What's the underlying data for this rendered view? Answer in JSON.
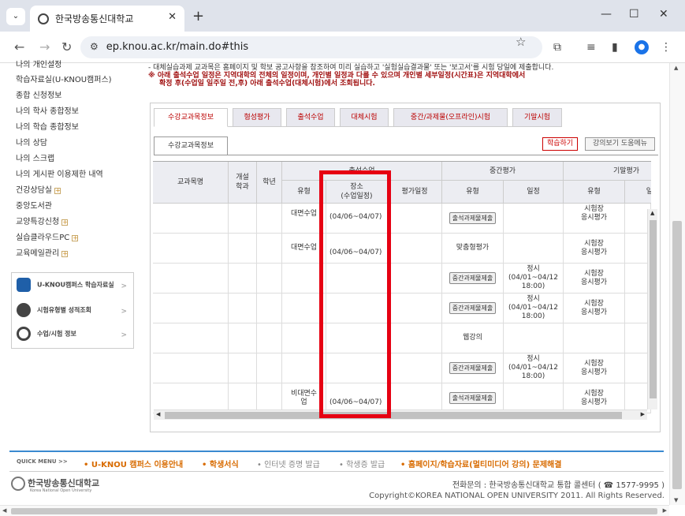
{
  "browser": {
    "tab_title": "한국방송통신대학교",
    "new_tab": "+",
    "url": "ep.knou.ac.kr/main.do#this"
  },
  "sidebar": {
    "items": [
      {
        "label": "나의 개인설정",
        "plus": false
      },
      {
        "label": "학습자료실(U-KNOU캠퍼스)",
        "plus": false
      },
      {
        "label": "종합 신청정보",
        "plus": false
      },
      {
        "label": "나의 학사 종합정보",
        "plus": false
      },
      {
        "label": "나의 학습 종합정보",
        "plus": false
      },
      {
        "label": "나의 상담",
        "plus": false
      },
      {
        "label": "나의 스크랩",
        "plus": false
      },
      {
        "label": "나의 게시판 이용제한 내역",
        "plus": false
      },
      {
        "label": "건강상담실",
        "plus": true
      },
      {
        "label": "중앙도서관",
        "plus": false
      },
      {
        "label": "교양특강신청",
        "plus": true
      },
      {
        "label": "실습클라우드PC",
        "plus": true
      },
      {
        "label": "교육메일관리",
        "plus": true
      }
    ],
    "box": [
      {
        "label": "U-KNOU캠퍼스 학습자료실",
        "icon": "u-knou-logo-icon"
      },
      {
        "label": "시험유형별 성적조회",
        "icon": "test-grade-icon"
      },
      {
        "label": "수업/시험 정보",
        "icon": "class-info-icon"
      }
    ]
  },
  "notice": {
    "line1": "- 대체실습과제 교과목은 홈페이지 및 학보 공고사항을 참조하여 미리 실습하고 '실험실습결과물' 또는 '보고서'를 시험 당일에 제출합니다.",
    "line2": "※ 아래 출석수업 일정은 지역대학의 전체의 일정이며, 개인별 일정과 다를 수 있으며 개인별 세부일정(시간표)은 지역대학에서",
    "line3": "확정 후(수업일 일주일 전,후) 아래 출석수업(대체시험)에서 조회됩니다."
  },
  "tabs": [
    "수강교과목정보",
    "형성평가",
    "출석수업",
    "대체시험",
    "중간/과제물(오프라인)시험",
    "기말시험"
  ],
  "subtab": "수강교과목정보",
  "buttons": {
    "study": "학습하기",
    "help": "강의보기 도움메뉴"
  },
  "table": {
    "headers": {
      "subject": "교과목명",
      "offer": "개설\n학과",
      "year": "학년",
      "attendance_group": "출석수업",
      "att_type": "유형",
      "att_place": "장소\n(수업일정)",
      "eval_date": "평가일정",
      "mid_group": "중간평가",
      "mid_type": "유형",
      "mid_date": "일정",
      "final_group": "기말평가",
      "final_type": "유형",
      "final_date": "일"
    },
    "rows": [
      {
        "att_type": "대면수업",
        "att_place": "(04/06~04/07)",
        "mid_button": "출석과제물제출",
        "mid_type": "",
        "mid_date": "",
        "final_type": "시험장\n응시평가"
      },
      {
        "att_type": "대면수업",
        "att_place": "(04/06~04/07)",
        "mid_button": "",
        "mid_type": "맞춤형평가",
        "mid_date": "",
        "final_type": "시험장\n응시평가"
      },
      {
        "att_type": "",
        "att_place": "",
        "mid_button": "중간과제물제출",
        "mid_type": "",
        "mid_date": "정시\n(04/01~04/12\n18:00)",
        "final_type": "시험장\n응시평가"
      },
      {
        "att_type": "",
        "att_place": "",
        "mid_button": "중간과제물제출",
        "mid_type": "",
        "mid_date": "정시\n(04/01~04/12\n18:00)",
        "final_type": "시험장\n응시평가"
      },
      {
        "att_type": "",
        "att_place": "",
        "mid_button": "",
        "mid_type": "웹강의",
        "mid_date": "",
        "final_type": ""
      },
      {
        "att_type": "",
        "att_place": "",
        "mid_button": "중간과제물제출",
        "mid_type": "",
        "mid_date": "정시\n(04/01~04/12\n18:00)",
        "final_type": "시험장\n응시평가"
      },
      {
        "att_type": "비대면수\n업",
        "att_place": "(04/06~04/07)",
        "mid_button": "출석과제물제출",
        "mid_type": "",
        "mid_date": "",
        "final_type": "시험장\n응시평가"
      }
    ]
  },
  "quick_menu": {
    "label": "QUICK MENU >>",
    "items": [
      {
        "label": "• U-KNOU 캠퍼스 이용안내",
        "color": "#d86b00"
      },
      {
        "label": "• 학생서식",
        "color": "#d86b00"
      },
      {
        "label": "• 인터넷 증명 발급",
        "color": "#888888"
      },
      {
        "label": "• 학생증 발급",
        "color": "#888888"
      },
      {
        "label": "• 홈페이지/학습자료(멀티미디어 강의) 문제해결",
        "color": "#d86b00"
      }
    ]
  },
  "footer": {
    "logo": "한국방송통신대학교",
    "logo_sub": "Korea National Open University",
    "contact": "전화문의 : 한국방송통신대학교 통합 콜센터 ( ☎ 1577-9995 )",
    "copyright": "Copyright©KOREA NATIONAL OPEN UNIVERSITY 2011. All Rights Reserved."
  },
  "highlight_color": "#e60012"
}
